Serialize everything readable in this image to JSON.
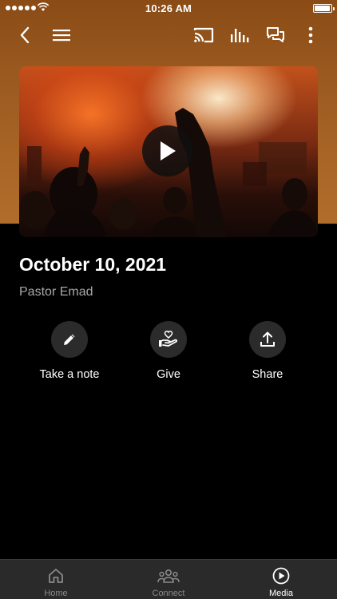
{
  "status_bar": {
    "time": "10:26 AM",
    "battery_level": 0.95
  },
  "toolbar": {
    "back_icon": "chevron-left-icon",
    "menu_icon": "hamburger-menu-icon",
    "cast_icon": "cast-icon",
    "audio_icon": "audio-bars-icon",
    "chat_icon": "chat-bubbles-icon",
    "more_icon": "more-vertical-icon"
  },
  "video": {
    "play_icon": "play-icon"
  },
  "sermon": {
    "title": "October 10, 2021",
    "speaker": "Pastor Emad"
  },
  "actions": [
    {
      "label": "Take a note",
      "icon": "pencil-icon"
    },
    {
      "label": "Give",
      "icon": "heart-hand-icon"
    },
    {
      "label": "Share",
      "icon": "share-upload-icon"
    }
  ],
  "tabs": [
    {
      "label": "Home",
      "icon": "home-icon",
      "active": false
    },
    {
      "label": "Connect",
      "icon": "people-icon",
      "active": false
    },
    {
      "label": "Media",
      "icon": "play-circle-icon",
      "active": true
    }
  ],
  "colors": {
    "hero_brown": "#9a5a20",
    "background": "#000000",
    "tabbar": "#2a2a2a",
    "action_circle": "#2b2b2b",
    "muted_text": "#a8a8a8"
  }
}
